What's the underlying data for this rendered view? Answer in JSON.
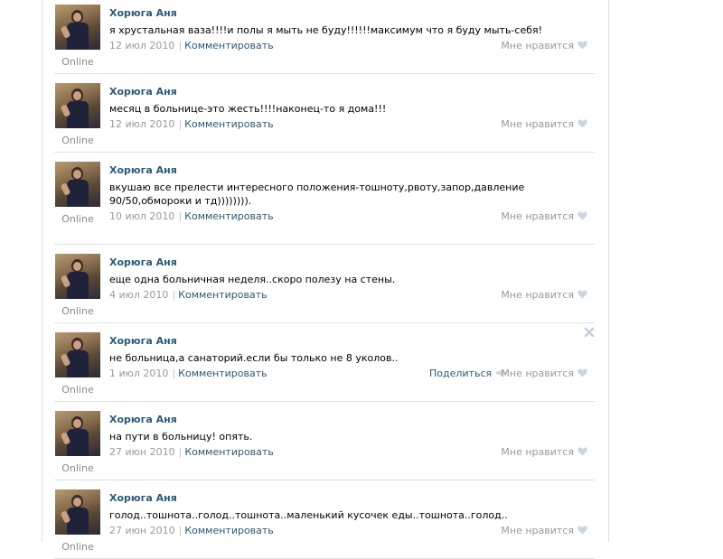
{
  "labels": {
    "online": "Online",
    "comment": "Комментировать",
    "like": "Мне нравится",
    "share": "Поделиться",
    "separator": "|"
  },
  "icons": {
    "like": "heart-icon",
    "share": "megaphone-icon",
    "close": "close-icon"
  },
  "colors": {
    "link": "#2b587a",
    "muted": "#999999",
    "separator": "#dae1e8",
    "icon": "#c9d6e2"
  },
  "posts": [
    {
      "author": "Хорюга Аня",
      "text": "я хрустальная ваза!!!!и полы я мыть не буду!!!!!!максимум что я буду мыть-себя!",
      "date": "12 июл 2010",
      "lines": 1,
      "share": false,
      "close": false
    },
    {
      "author": "Хорюга Аня",
      "text": "месяц в больнице-это жесть!!!!наконец-то я дома!!!",
      "date": "12 июл 2010",
      "lines": 1,
      "share": false,
      "close": false
    },
    {
      "author": "Хорюга Аня",
      "text": "вкушаю все прелести интересного положения-тошноту,рвоту,запор,давление 90/50,обмороки и тд)))))))).",
      "date": "10 июл 2010",
      "lines": 2,
      "share": false,
      "close": false
    },
    {
      "author": "Хорюга Аня",
      "text": "еще одна больничная неделя..скоро полезу на стены.",
      "date": "4 июл 2010",
      "lines": 1,
      "share": false,
      "close": false
    },
    {
      "author": "Хорюга Аня",
      "text": "не больница,а санаторий.если бы только не 8 уколов..",
      "date": "1 июл 2010",
      "lines": 1,
      "share": true,
      "close": true
    },
    {
      "author": "Хорюга Аня",
      "text": "на пути в больницу! опять.",
      "date": "27 июн 2010",
      "lines": 1,
      "share": false,
      "close": false
    },
    {
      "author": "Хорюга Аня",
      "text": "голод..тошнота..голод..тошнота..маленький кусочек еды..тошнота..голод..",
      "date": "27 июн 2010",
      "lines": 1,
      "share": false,
      "close": false
    }
  ]
}
